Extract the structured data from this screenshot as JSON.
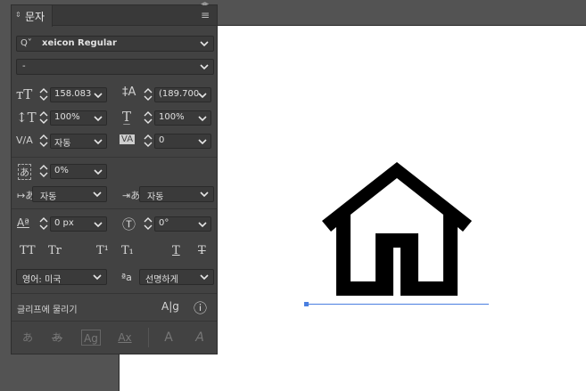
{
  "panel": {
    "tab_label": "문자",
    "font_search_label": "Q˅",
    "font_family": "xeicon Regular",
    "font_style": "-",
    "font_size": "158.083",
    "leading": "(189.700",
    "vertical_scale": "100%",
    "horizontal_scale": "100%",
    "kerning": "자동",
    "tracking": "0",
    "tsume": "0%",
    "aki_left": "자동",
    "aki_right": "자동",
    "baseline_shift": "0 px",
    "rotation": "0°",
    "caps": [
      "TT",
      "Tr",
      "T¹",
      "T₁",
      "T",
      "T"
    ],
    "language": "영어: 미국",
    "antialias_icon": "ªa",
    "antialias": "선명하게",
    "snap_label": "글리프에 물리기",
    "snap_icon": "A|g",
    "info_icon": "ⓘ",
    "bottom_buttons": [
      "あ",
      "あ",
      "Ag",
      "Ax",
      "A",
      "A"
    ]
  },
  "colors": {
    "panel_bg": "#424242",
    "accent": "#4a7fe0",
    "artboard": "#ffffff"
  }
}
